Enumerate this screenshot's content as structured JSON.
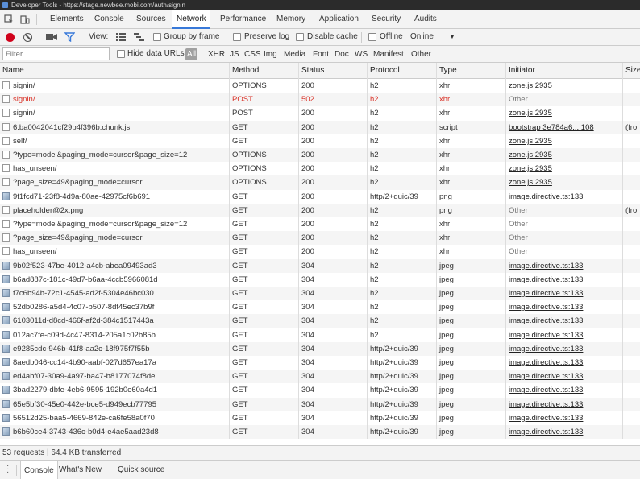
{
  "window": {
    "title": "Developer Tools - https://stage.newbee.mobi.com/auth/signin"
  },
  "tabs": [
    "Elements",
    "Console",
    "Sources",
    "Network",
    "Performance",
    "Memory",
    "Application",
    "Security",
    "Audits"
  ],
  "active_tab": "Network",
  "toolbar": {
    "view_label": "View:",
    "group_by_frame": "Group by frame",
    "preserve_log": "Preserve log",
    "disable_cache": "Disable cache",
    "offline": "Offline",
    "throttle": "Online"
  },
  "filter": {
    "placeholder": "Filter",
    "hide_data_urls": "Hide data URLs",
    "types": [
      "All",
      "XHR",
      "JS",
      "CSS",
      "Img",
      "Media",
      "Font",
      "Doc",
      "WS",
      "Manifest",
      "Other"
    ],
    "active_type": "All"
  },
  "columns": [
    "Name",
    "Method",
    "Status",
    "Protocol",
    "Type",
    "Initiator",
    "Size"
  ],
  "rows": [
    {
      "name": "signin/",
      "method": "OPTIONS",
      "status": "200",
      "protocol": "h2",
      "type": "xhr",
      "initiator": "zone.js:2935",
      "size": "",
      "icon": "doc",
      "error": false,
      "link": true
    },
    {
      "name": "signin/",
      "method": "POST",
      "status": "502",
      "protocol": "h2",
      "type": "xhr",
      "initiator": "Other",
      "size": "",
      "icon": "doc",
      "error": true,
      "link": false
    },
    {
      "name": "signin/",
      "method": "POST",
      "status": "200",
      "protocol": "h2",
      "type": "xhr",
      "initiator": "zone.js:2935",
      "size": "",
      "icon": "doc",
      "error": false,
      "link": true
    },
    {
      "name": "6.ba0042041cf29b4f396b.chunk.js",
      "method": "GET",
      "status": "200",
      "protocol": "h2",
      "type": "script",
      "initiator": "bootstrap 3e784a6...:108",
      "size": "(fro",
      "icon": "doc",
      "error": false,
      "link": true
    },
    {
      "name": "self/",
      "method": "GET",
      "status": "200",
      "protocol": "h2",
      "type": "xhr",
      "initiator": "zone.js:2935",
      "size": "",
      "icon": "doc",
      "error": false,
      "link": true
    },
    {
      "name": "?type=model&paging_mode=cursor&page_size=12",
      "method": "OPTIONS",
      "status": "200",
      "protocol": "h2",
      "type": "xhr",
      "initiator": "zone.js:2935",
      "size": "",
      "icon": "doc",
      "error": false,
      "link": true
    },
    {
      "name": "has_unseen/",
      "method": "OPTIONS",
      "status": "200",
      "protocol": "h2",
      "type": "xhr",
      "initiator": "zone.js:2935",
      "size": "",
      "icon": "doc",
      "error": false,
      "link": true
    },
    {
      "name": "?page_size=49&paging_mode=cursor",
      "method": "OPTIONS",
      "status": "200",
      "protocol": "h2",
      "type": "xhr",
      "initiator": "zone.js:2935",
      "size": "",
      "icon": "doc",
      "error": false,
      "link": true
    },
    {
      "name": "9f1fcd71-23f8-4d9a-80ae-42975cf6b691",
      "method": "GET",
      "status": "200",
      "protocol": "http/2+quic/39",
      "type": "png",
      "initiator": "image.directive.ts:133",
      "size": "",
      "icon": "img",
      "error": false,
      "link": true
    },
    {
      "name": "placeholder@2x.png",
      "method": "GET",
      "status": "200",
      "protocol": "h2",
      "type": "png",
      "initiator": "Other",
      "size": "(fro",
      "icon": "doc",
      "error": false,
      "link": false
    },
    {
      "name": "?type=model&paging_mode=cursor&page_size=12",
      "method": "GET",
      "status": "200",
      "protocol": "h2",
      "type": "xhr",
      "initiator": "Other",
      "size": "",
      "icon": "doc",
      "error": false,
      "link": false
    },
    {
      "name": "?page_size=49&paging_mode=cursor",
      "method": "GET",
      "status": "200",
      "protocol": "h2",
      "type": "xhr",
      "initiator": "Other",
      "size": "",
      "icon": "doc",
      "error": false,
      "link": false
    },
    {
      "name": "has_unseen/",
      "method": "GET",
      "status": "200",
      "protocol": "h2",
      "type": "xhr",
      "initiator": "Other",
      "size": "",
      "icon": "doc",
      "error": false,
      "link": false
    },
    {
      "name": "9b02f523-47be-4012-a4cb-abea09493ad3",
      "method": "GET",
      "status": "304",
      "protocol": "h2",
      "type": "jpeg",
      "initiator": "image.directive.ts:133",
      "size": "",
      "icon": "img",
      "error": false,
      "link": true
    },
    {
      "name": "b6ad887c-181c-49d7-b6aa-4ccb5966081d",
      "method": "GET",
      "status": "304",
      "protocol": "h2",
      "type": "jpeg",
      "initiator": "image.directive.ts:133",
      "size": "",
      "icon": "img",
      "error": false,
      "link": true
    },
    {
      "name": "f7c6b94b-72c1-4545-ad2f-5304e46bc030",
      "method": "GET",
      "status": "304",
      "protocol": "h2",
      "type": "jpeg",
      "initiator": "image.directive.ts:133",
      "size": "",
      "icon": "img",
      "error": false,
      "link": true
    },
    {
      "name": "52db0286-a5d4-4c07-b507-8df45ec37b9f",
      "method": "GET",
      "status": "304",
      "protocol": "h2",
      "type": "jpeg",
      "initiator": "image.directive.ts:133",
      "size": "",
      "icon": "img",
      "error": false,
      "link": true
    },
    {
      "name": "6103011d-d8cd-466f-af2d-384c1517443a",
      "method": "GET",
      "status": "304",
      "protocol": "h2",
      "type": "jpeg",
      "initiator": "image.directive.ts:133",
      "size": "",
      "icon": "img",
      "error": false,
      "link": true
    },
    {
      "name": "012ac7fe-c09d-4c47-8314-205a1c02b85b",
      "method": "GET",
      "status": "304",
      "protocol": "h2",
      "type": "jpeg",
      "initiator": "image.directive.ts:133",
      "size": "",
      "icon": "img",
      "error": false,
      "link": true
    },
    {
      "name": "e9285cdc-946b-41f8-aa2c-18f975f7f55b",
      "method": "GET",
      "status": "304",
      "protocol": "http/2+quic/39",
      "type": "jpeg",
      "initiator": "image.directive.ts:133",
      "size": "",
      "icon": "img",
      "error": false,
      "link": true
    },
    {
      "name": "8aedb046-cc14-4b90-aabf-027d657ea17a",
      "method": "GET",
      "status": "304",
      "protocol": "http/2+quic/39",
      "type": "jpeg",
      "initiator": "image.directive.ts:133",
      "size": "",
      "icon": "img",
      "error": false,
      "link": true
    },
    {
      "name": "ed4abf07-30a9-4a97-ba47-b8177074f8de",
      "method": "GET",
      "status": "304",
      "protocol": "http/2+quic/39",
      "type": "jpeg",
      "initiator": "image.directive.ts:133",
      "size": "",
      "icon": "img",
      "error": false,
      "link": true
    },
    {
      "name": "3bad2279-dbfe-4eb6-9595-192b0e60a4d1",
      "method": "GET",
      "status": "304",
      "protocol": "http/2+quic/39",
      "type": "jpeg",
      "initiator": "image.directive.ts:133",
      "size": "",
      "icon": "img",
      "error": false,
      "link": true
    },
    {
      "name": "65e5bf30-45e0-442e-bce5-d949ecb77795",
      "method": "GET",
      "status": "304",
      "protocol": "http/2+quic/39",
      "type": "jpeg",
      "initiator": "image.directive.ts:133",
      "size": "",
      "icon": "img",
      "error": false,
      "link": true
    },
    {
      "name": "56512d25-baa5-4669-842e-ca6fe58a0f70",
      "method": "GET",
      "status": "304",
      "protocol": "http/2+quic/39",
      "type": "jpeg",
      "initiator": "image.directive.ts:133",
      "size": "",
      "icon": "img",
      "error": false,
      "link": true
    },
    {
      "name": "b6b60ce4-3743-436c-b0d4-e4ae5aad23d8",
      "method": "GET",
      "status": "304",
      "protocol": "http/2+quic/39",
      "type": "jpeg",
      "initiator": "image.directive.ts:133",
      "size": "",
      "icon": "img",
      "error": false,
      "link": true
    }
  ],
  "status": "53 requests | 64.4 KB transferred",
  "drawer": {
    "tabs": [
      "Console",
      "What's New",
      "Quick source"
    ],
    "active": "Console"
  }
}
